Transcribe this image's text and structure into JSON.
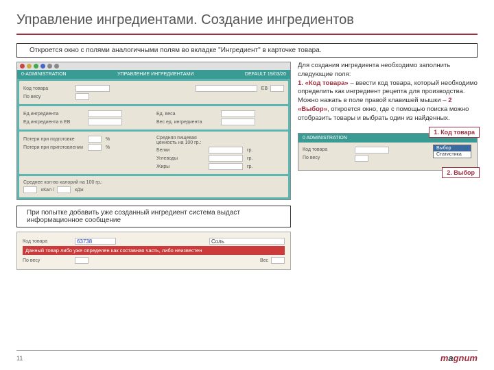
{
  "title": "Управление ингредиентами. Создание ингредиентов",
  "note_top": "Откроется окно с полями аналогичными полям во вкладке \"Ингредиент\" в карточке товара.",
  "app": {
    "left": "0-ADMINISTRATION",
    "center": "УПРАВЛЕНИЕ ИНГРЕДИЕНТАМИ",
    "right": "DEFAULT   19/03/20",
    "sec1": {
      "kod": "Код товара",
      "poves": "По весу",
      "ei": "ЕВ"
    },
    "sec2": {
      "eding": "Ед.ингредиента",
      "edingev": "Ед.ингредиента в ЕВ",
      "edvesa": "Ед. веса",
      "vesing": "Вес ед. ингредиента"
    },
    "sec3": {
      "pp": "Потери при подготовке",
      "ppr": "Потери при приготовлении",
      "pct": "%",
      "spc": "Средняя пищевая ценность на 100 гр.:",
      "belki": "Белки",
      "ugl": "Углеводы",
      "zhiry": "Жиры",
      "gr": "гр."
    },
    "sec4": {
      "skk": "Среднее кол-во калорий на 100 гр.:",
      "kkal": "кКал  /",
      "kdj": "кДж"
    }
  },
  "instr": {
    "l1": "Для создания ингредиента необходимо заполнить следующие поля:",
    "b1": "1. «Код товара»",
    "l2": " – ввести код товара, который необходимо определить как ингредиент рецепта для производства. Можно нажать в поле правой клавишей мышки – ",
    "b2": "2 «Выбор»",
    "l3": ", откроется окно, где с помощью поиска можно отобразить товары и выбрать один из найденных."
  },
  "mini": {
    "header": "0 ADMINISTRATION",
    "kod": "Код товара",
    "poves": "По весу",
    "menu1": "Выбор",
    "menu2": "Статистика"
  },
  "callout1": "1. Код товара",
  "callout2": "2. Выбор",
  "note_bottom": "При попытке добавить уже созданный ингредиент система выдаст информационное сообщение",
  "error": {
    "kod": "Код товара",
    "codeval": "63738",
    "name": "Соль",
    "msg": "Данный товар либо уже определен как составная часть, либо неизвестен",
    "poves": "По весу",
    "ves": "Вес"
  },
  "page": "11",
  "logo": "m",
  "logo2": "a",
  "logo3": "gnum"
}
